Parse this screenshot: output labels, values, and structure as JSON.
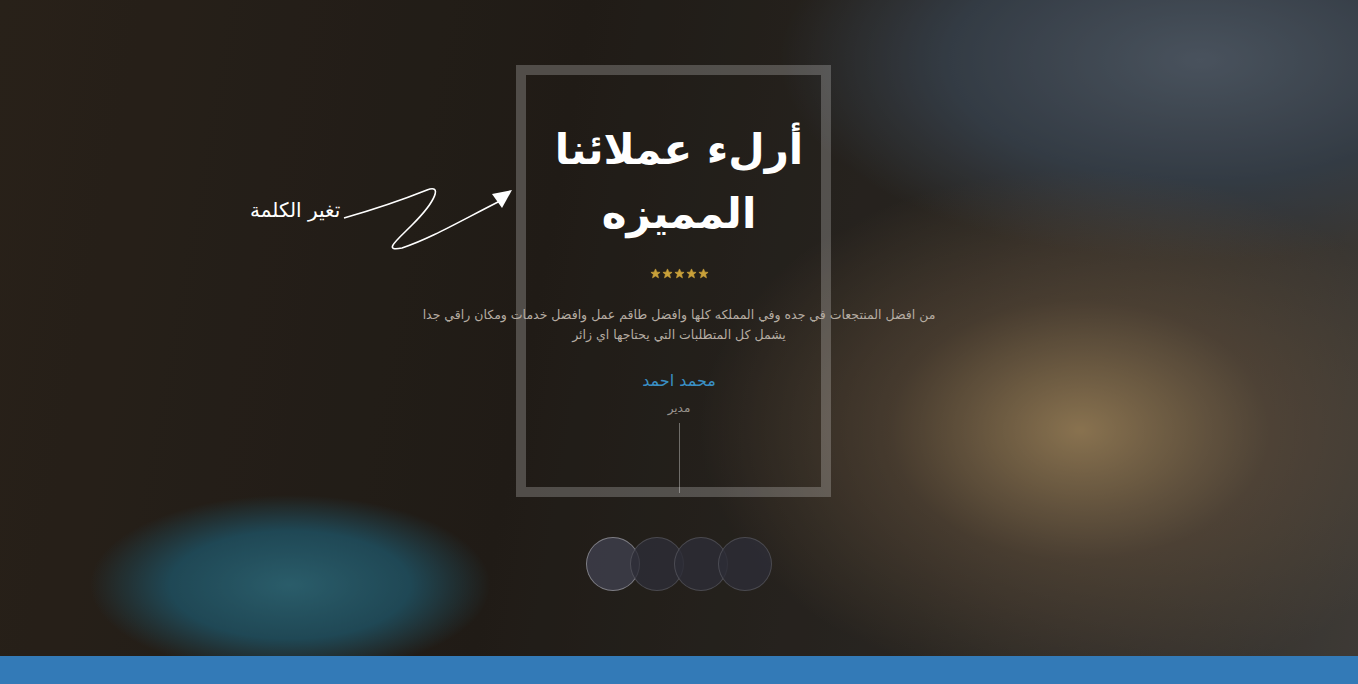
{
  "hero": {
    "title_lines": [
      "أرلء عملائنا",
      "المميزه"
    ],
    "annotation": "تغير الكلمة"
  },
  "testimonial": {
    "stars": 5,
    "text": "من افضل المنتجعات في جده وفي المملكه كلها وافضل طاقم عمل وافضل خدمات ومكان راقي جدا يشمل كل المتطلبات التي يحتاجها اي زائر",
    "name": "محمد احمد",
    "role": "مدير"
  },
  "slides": [
    {
      "selected": true
    },
    {
      "selected": false
    },
    {
      "selected": false
    },
    {
      "selected": false
    }
  ]
}
